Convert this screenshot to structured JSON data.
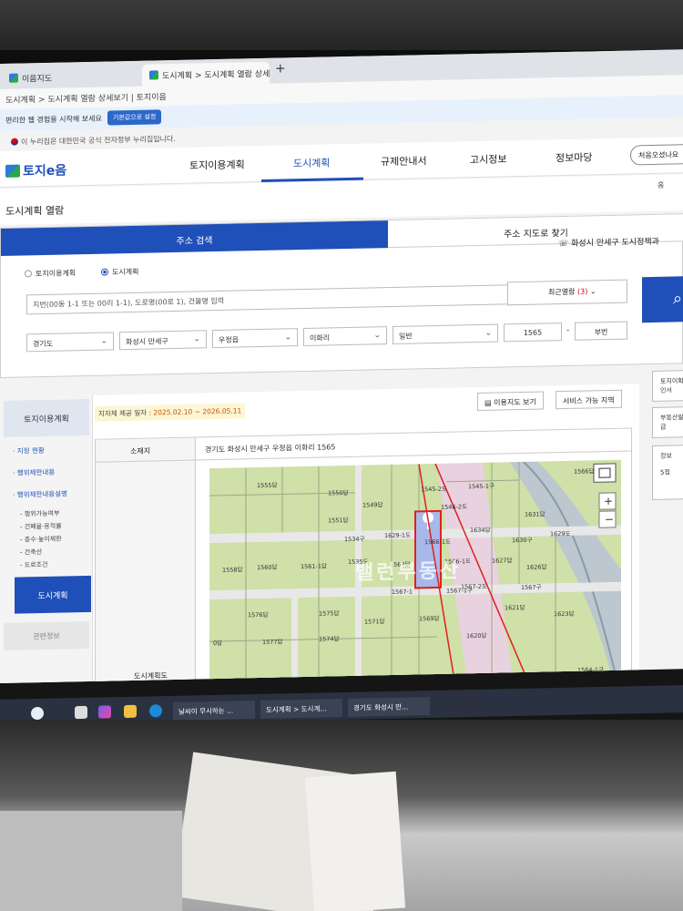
{
  "browser": {
    "tabs": [
      {
        "label": "이음지도"
      },
      {
        "label": "도시계획 > 도시계획 열람 상세"
      }
    ],
    "addressbar": "도시계획 > 도시계획 열람 상세보기 | 토지이음",
    "infobar_text": "편리한 웹 경험을 시작해 보세요",
    "infobar_button": "기본값으로 설정"
  },
  "gov_notice": "이 누리집은 대한민국 공식 전자정부 누리집입니다.",
  "site": {
    "logo": "토지e음",
    "nav": [
      "토지이용계획",
      "도시계획",
      "규제안내서",
      "고시정보",
      "정보마당"
    ],
    "welcome": "처음오셨나요",
    "page_title": "도시계획 열람",
    "home": "홈"
  },
  "search": {
    "tab_address": "주소 검색",
    "tab_map": "주소 지도로 찾기",
    "radio_land": "토지이용계획",
    "radio_city": "도시계획",
    "policy": "화성시 만세구 도시정책과",
    "placeholder": "지번(00동 1-1 또는 00리 1-1), 도로명(00로 1), 건물명 입력",
    "recent_label": "최근열람",
    "recent_count": "(3)",
    "selects": [
      "경기도",
      "화성시 만세구",
      "우정읍",
      "이화리",
      "일반"
    ],
    "main_no": "1565",
    "dash": "-",
    "sub_no": "부번"
  },
  "left_menu": {
    "head": "토지이용계획",
    "items": [
      "지정 현황",
      "행위제한내용",
      "행위제한내용설명"
    ],
    "subitems": [
      "행위가능여부",
      "건폐율·용적률",
      "층수·높이제한",
      "건축선",
      "도로조건"
    ],
    "active": "도시계획",
    "related": "관련정보"
  },
  "content": {
    "date_label": "지자체 제공 일자 :",
    "date_value": "2025.02.10 ~ 2026.05.11",
    "btn_map": "이용지도 보기",
    "btn_service": "서비스 가능 지역",
    "th_location": "소재지",
    "th_plan": "도시계획도",
    "location": "경기도 화성시 만세구 우정읍 이화리 1565"
  },
  "map": {
    "watermark": "밸런부동산",
    "lots": [
      "1555답",
      "1550답",
      "1549답",
      "1551답",
      "1545-2도",
      "1545-1구",
      "1546-2도",
      "1631답",
      "1634답",
      "1566답",
      "1534구",
      "1629-1도",
      "1566-1도",
      "1630구",
      "1629도",
      "1558답",
      "1560답",
      "1561-1답",
      "1535도",
      "1564답",
      "1566-1도",
      "1627답",
      "1626답",
      "1567-1구",
      "1567-2도",
      "1567구",
      "1576답",
      "1575답",
      "1571답",
      "1569답",
      "1621답",
      "1623답",
      "1577답",
      "1574답",
      "1620답",
      "0답",
      "1564-1구",
      "1567-1"
    ]
  },
  "right_side": {
    "b1": "토지이확인서",
    "b2": "부동산발급",
    "b3": "정보",
    "b4": "5점"
  },
  "taskbar": {
    "items": [
      "날씨이 무시하는 ...",
      "도시계획 > 도시계...",
      "경기도 화성시 만..."
    ]
  },
  "colors": {
    "brand_blue": "#1f4fb8",
    "field_green": "#cfe0a8",
    "boundary_red": "#e02020"
  }
}
